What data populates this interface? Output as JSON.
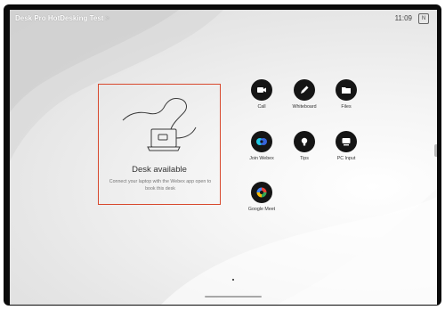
{
  "header": {
    "title": "Desk Pro HotDesking Test",
    "chevron": ">",
    "clock": "11:09",
    "lang_badge": "N"
  },
  "desk": {
    "title": "Desk available",
    "subtitle": "Connect your laptop with the Webex app open to book this desk",
    "highlight_color": "#d8492e"
  },
  "apps": [
    {
      "label": "Call",
      "icon": "video-camera-icon"
    },
    {
      "label": "Whiteboard",
      "icon": "pen-icon"
    },
    {
      "label": "Files",
      "icon": "folder-icon"
    },
    {
      "label": "Join Webex",
      "icon": "webex-logo-icon"
    },
    {
      "label": "Tips",
      "icon": "lightbulb-icon"
    },
    {
      "label": "PC Input",
      "icon": "monitor-icon"
    },
    {
      "label": "Google Meet",
      "icon": "google-meet-icon"
    }
  ]
}
